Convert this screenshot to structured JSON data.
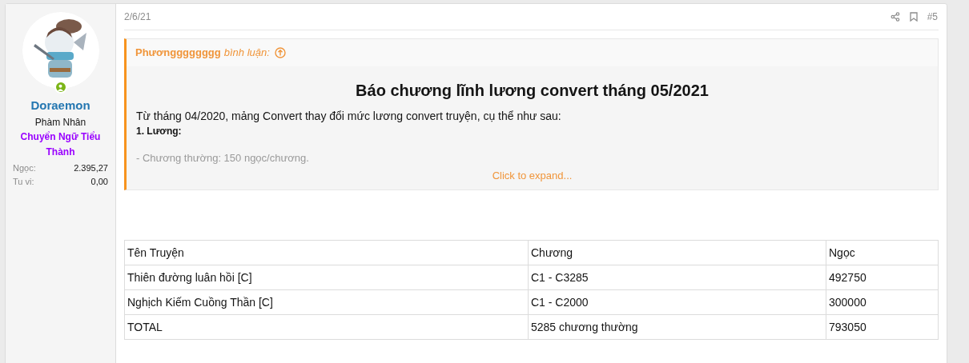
{
  "user": {
    "name": "Doraemon",
    "rank": "Phàm Nhân",
    "title": "Chuyển Ngữ Tiểu Thành",
    "online": true,
    "stats": [
      {
        "label": "Ngọc:",
        "value": "2.395,27"
      },
      {
        "label": "Tu vi:",
        "value": "0,00"
      }
    ]
  },
  "post": {
    "date": "2/6/21",
    "number": "#5",
    "quote": {
      "author": "Phươngggggggg",
      "verb": "bình luận:",
      "title": "Báo chương lĩnh lương convert tháng 05/2021",
      "text": "Từ tháng 04/2020, mảng Convert thay đổi mức lương convert truyện, cụ thể như sau:",
      "heading": "1. Lương:",
      "faded": "- Chương thường: 150 ngọc/chương.",
      "expand": "Click to expand..."
    },
    "table": {
      "columns": [
        "Tên Truyện",
        "Chương",
        "Ngọc"
      ],
      "rows": [
        [
          "Thiên đường luân hồi [C]",
          "C1 - C3285",
          "492750"
        ],
        [
          "Nghịch Kiếm Cuồng Thần [C]",
          "C1 - C2000",
          "300000"
        ],
        [
          "TOTAL",
          "5285 chương thường",
          "793050"
        ]
      ]
    }
  }
}
